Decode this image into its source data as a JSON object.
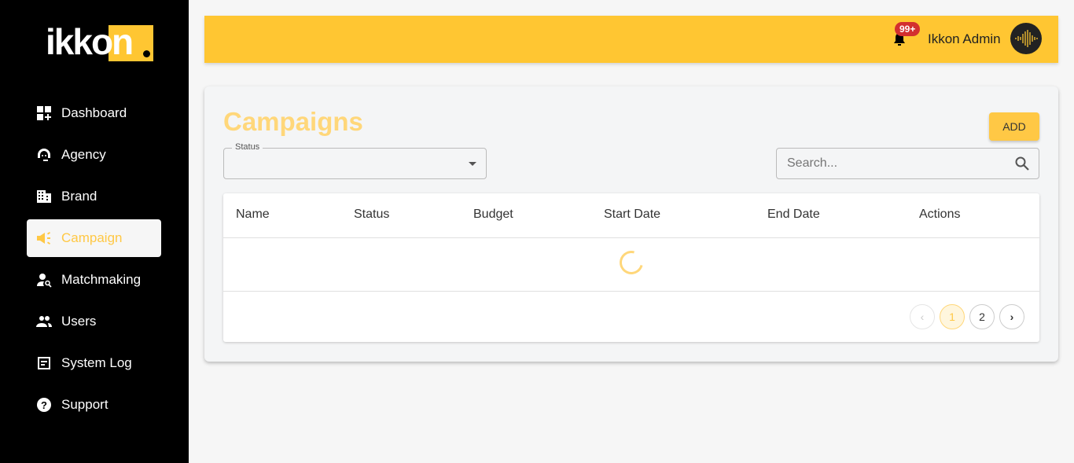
{
  "brand": {
    "logo": "ikkon",
    "accent": "#ffc632"
  },
  "sidebar": {
    "items": [
      {
        "label": "Dashboard"
      },
      {
        "label": "Agency"
      },
      {
        "label": "Brand"
      },
      {
        "label": "Campaign"
      },
      {
        "label": "Matchmaking"
      },
      {
        "label": "Users"
      },
      {
        "label": "System Log"
      },
      {
        "label": "Support"
      }
    ]
  },
  "header": {
    "badge": "99+",
    "user": "Ikkon Admin"
  },
  "main": {
    "title": "Campaigns",
    "add_label": "ADD",
    "status_label": "Status",
    "search_placeholder": "Search...",
    "columns": [
      "Name",
      "Status",
      "Budget",
      "Start Date",
      "End Date",
      "Actions"
    ],
    "pages": [
      "1",
      "2"
    ]
  }
}
